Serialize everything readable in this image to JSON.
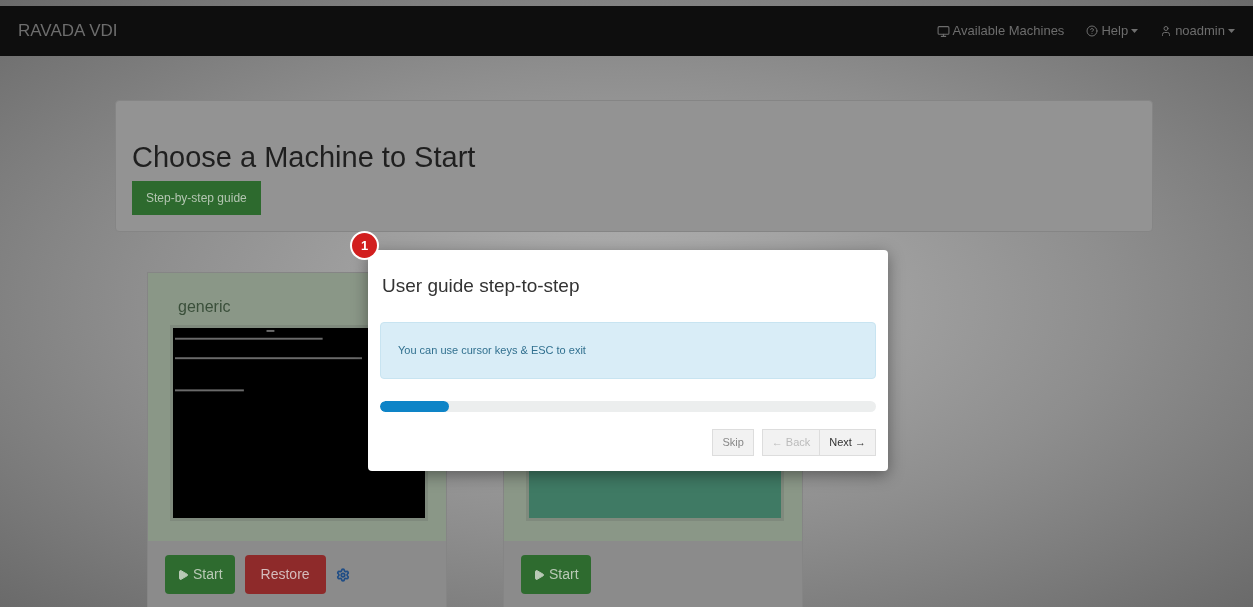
{
  "navbar": {
    "brand": "RAVADA VDI",
    "items": [
      {
        "kind": "machines",
        "label": "Available Machines"
      },
      {
        "kind": "help",
        "label": "Help"
      },
      {
        "kind": "user",
        "label": "noadmin"
      }
    ]
  },
  "header": {
    "title": "Choose a Machine to Start",
    "guide_button": "Step-by-step guide"
  },
  "machines": [
    {
      "name": "generic",
      "screen": {
        "kind": "picture"
      },
      "buttons": [
        {
          "kind": "start",
          "label": "Start"
        },
        {
          "kind": "restore",
          "label": "Restore"
        },
        {
          "kind": "settings"
        }
      ]
    },
    {
      "screen": {
        "kind": "picture"
      },
      "buttons": [
        {
          "kind": "start",
          "label": "Start"
        }
      ]
    }
  ],
  "tour": {
    "step": "1",
    "title": "User guide step-to-step",
    "message": "You can use cursor keys & ESC to exit",
    "level": 0.14,
    "buttons": [
      {
        "label": "Skip",
        "disabled": false
      },
      {
        "label": "← Back",
        "disabled": true
      },
      {
        "label": "Next →",
        "disabled": false
      }
    ]
  }
}
